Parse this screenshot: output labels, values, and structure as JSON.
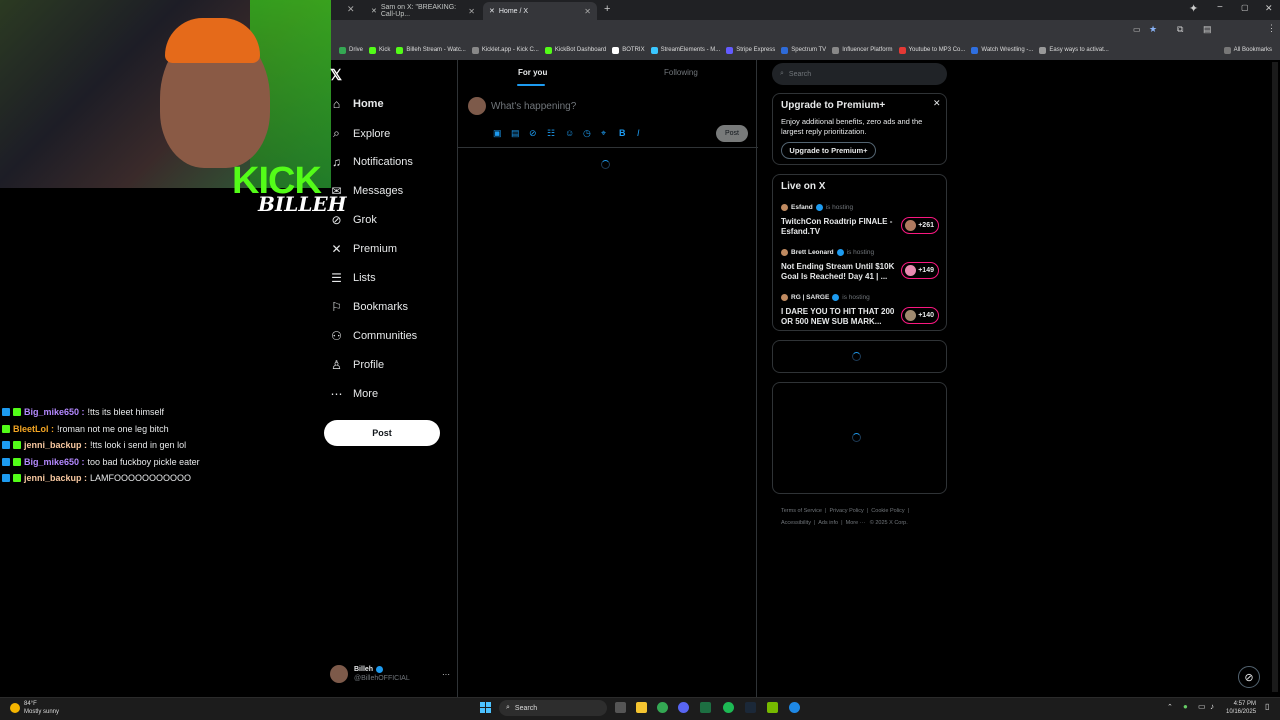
{
  "browser": {
    "tabs": [
      {
        "title": "Sam on X: \"BREAKING: Call-Up...",
        "active": false
      },
      {
        "title": "Home / X",
        "active": true
      }
    ],
    "bookmarks": [
      "Drive",
      "Kick",
      "Billeh Stream - Watc...",
      "Kicklet.app - Kick C...",
      "KickBot Dashboard",
      "BOTRIX",
      "StreamElements - M...",
      "Stripe Express",
      "Spectrum TV",
      "Influencer Platform",
      "Youtube to MP3 Co...",
      "Watch Wrestling -...",
      "Easy ways to activat..."
    ],
    "all_bookmarks": "All Bookmarks"
  },
  "stream": {
    "kick_logo": "KICK",
    "billeh_logo": "BILLEH",
    "chat": [
      {
        "user": "Big_mike650",
        "color": "#b388ff",
        "message": "!tts its bleet himself"
      },
      {
        "user": "BleetLol",
        "color": "#f5a623",
        "message": "!roman not me one leg bitch"
      },
      {
        "user": "jenni_backup",
        "color": "#f8c8a0",
        "message": "!tts look i send in gen lol"
      },
      {
        "user": "Big_mike650",
        "color": "#b388ff",
        "message": "too bad fuckboy pickle eater"
      },
      {
        "user": "jenni_backup",
        "color": "#f8c8a0",
        "message": "LAMFOOOOOOOOOOO"
      }
    ]
  },
  "x": {
    "nav": [
      {
        "label": "Home",
        "icon": "home-icon",
        "glyph": "⌂"
      },
      {
        "label": "Explore",
        "icon": "search-icon",
        "glyph": "⌕"
      },
      {
        "label": "Notifications",
        "icon": "bell-icon",
        "glyph": "♫"
      },
      {
        "label": "Messages",
        "icon": "mail-icon",
        "glyph": "✉"
      },
      {
        "label": "Grok",
        "icon": "grok-icon",
        "glyph": "⊘"
      },
      {
        "label": "Premium",
        "icon": "x-icon",
        "glyph": "✕"
      },
      {
        "label": "Lists",
        "icon": "list-icon",
        "glyph": "☰"
      },
      {
        "label": "Bookmarks",
        "icon": "bookmark-icon",
        "glyph": "⚐"
      },
      {
        "label": "Communities",
        "icon": "people-icon",
        "glyph": "⚇"
      },
      {
        "label": "Profile",
        "icon": "person-icon",
        "glyph": "♙"
      },
      {
        "label": "More",
        "icon": "more-icon",
        "glyph": "⋯"
      }
    ],
    "post_button": "Post",
    "account": {
      "name": "Billeh",
      "handle": "@BillehOFFICIAL"
    },
    "feed_tabs": [
      "For you",
      "Following"
    ],
    "composer_placeholder": "What's happening?",
    "composer_post": "Post",
    "search_placeholder": "Search",
    "premium": {
      "title": "Upgrade to Premium+",
      "text": "Enjoy additional benefits, zero ads and the largest reply prioritization.",
      "button": "Upgrade to Premium+"
    },
    "live": {
      "title": "Live on X",
      "hosting": "is hosting",
      "items": [
        {
          "host": "Esfand",
          "title": "TwitchCon Roadtrip FINALE - Esfand.TV",
          "count": "+261"
        },
        {
          "host": "Brett Leonard",
          "title": "Not Ending Stream Until $10K Goal Is Reached! Day 41 | ...",
          "count": "+149"
        },
        {
          "host": "RG | SARGE",
          "title": "I DARE YOU TO HIT THAT 200 OR 500 NEW SUB MARK...",
          "count": "+140"
        }
      ]
    },
    "footer": [
      "Terms of Service",
      "Privacy Policy",
      "Cookie Policy",
      "Accessibility",
      "Ads info",
      "More ···",
      "© 2025 X Corp."
    ]
  },
  "taskbar": {
    "weather_temp": "84°F",
    "weather_desc": "Mostly sunny",
    "search": "Search",
    "time": "4:57 PM",
    "date": "10/16/2025"
  },
  "colors": {
    "accent": "#1d9bf0",
    "kick": "#53fc18",
    "live": "#f91880"
  }
}
